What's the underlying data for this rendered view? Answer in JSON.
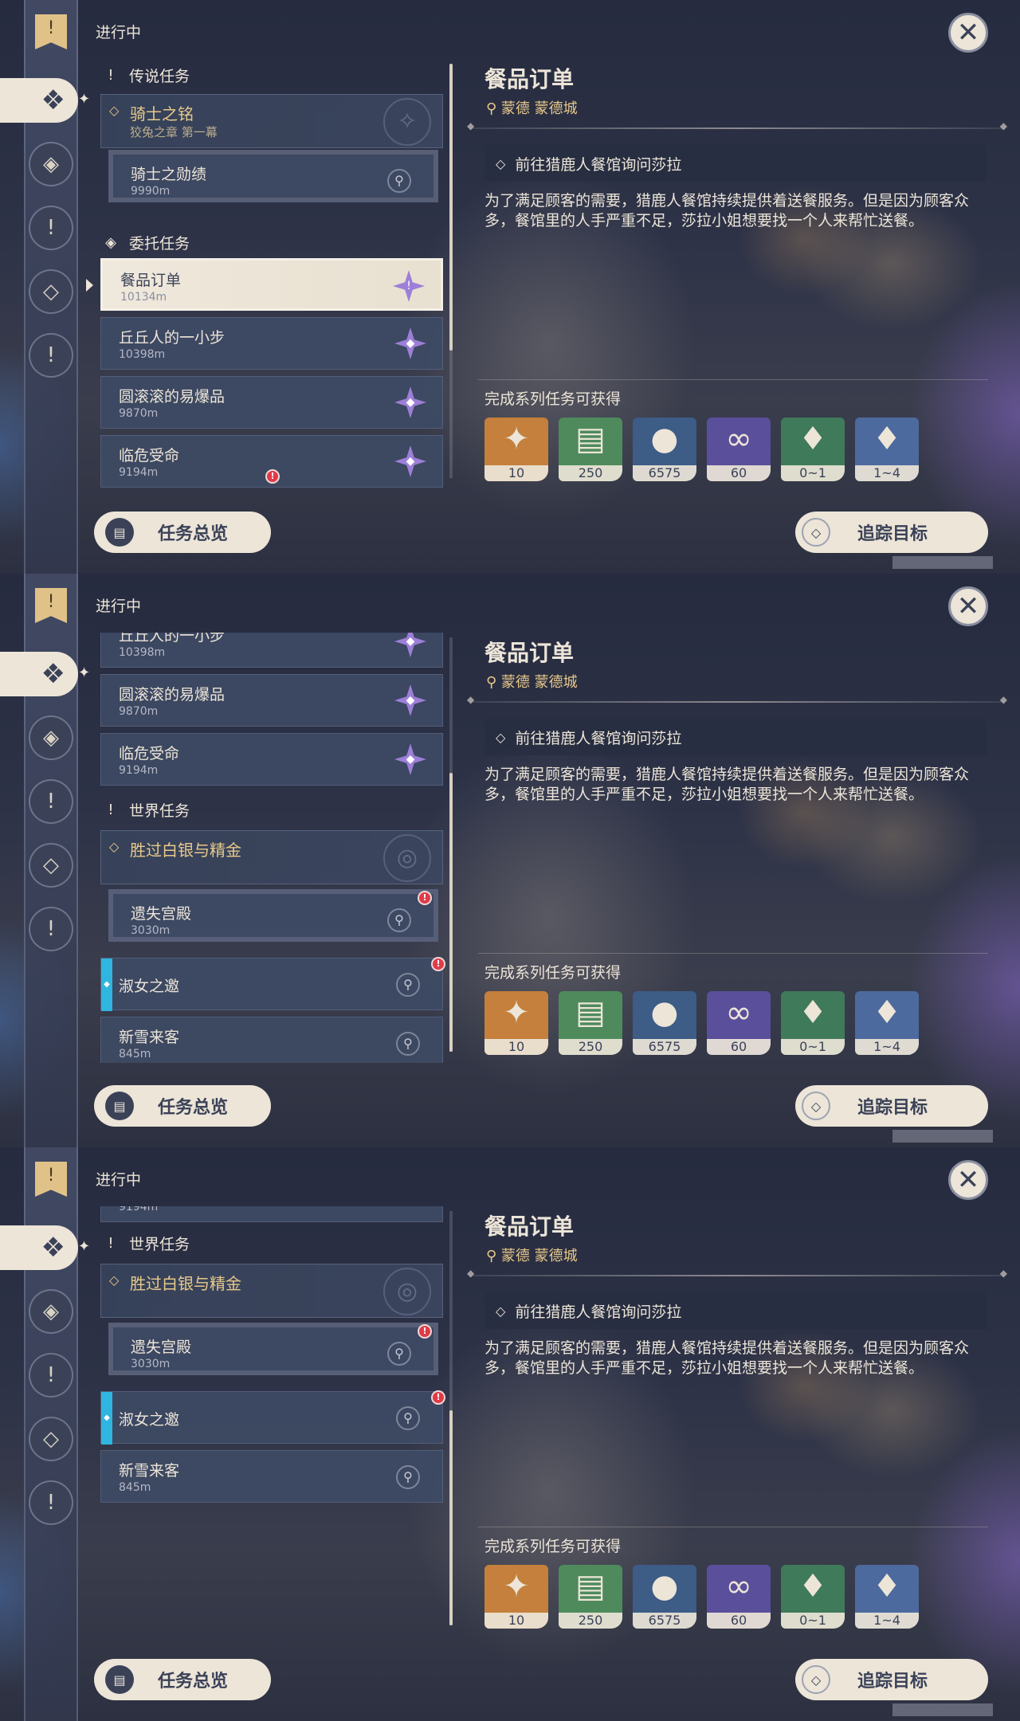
{
  "common": {
    "status": "进行中",
    "close_icon": "✕",
    "detail": {
      "title": "餐品订单",
      "location": "蒙德 蒙德城",
      "objective": "前往猎鹿人餐馆询问莎拉",
      "description": "为了满足顾客的需要，猎鹿人餐馆持续提供着送餐服务。但是因为顾客众多，餐馆里的人手严重不足，莎拉小姐想要找一个人来帮忙送餐。",
      "reward_label": "完成系列任务可获得"
    },
    "rewards": [
      {
        "name": "primogem",
        "count": "10",
        "color": "#c4803c"
      },
      {
        "name": "adventure-exp",
        "count": "250",
        "color": "#4e8a5c"
      },
      {
        "name": "mora",
        "count": "6575",
        "color": "#3d5c86"
      },
      {
        "name": "companionship-exp",
        "count": "60",
        "color": "#5a4f9a"
      },
      {
        "name": "crystal-chunk",
        "count": "0~1",
        "color": "#3f7a5a"
      },
      {
        "name": "mystic-ore",
        "count": "1~4",
        "color": "#4d6a9e"
      }
    ],
    "buttons": {
      "overview": "任务总览",
      "track": "追踪目标"
    }
  },
  "cats": {
    "legend": "传说任务",
    "commission": "委托任务",
    "world": "世界任务"
  },
  "quests": {
    "legend_series": {
      "title": "骑士之铭",
      "sub": "狡兔之章 第一幕"
    },
    "knight": {
      "title": "骑士之勋绩",
      "dist": "9990m"
    },
    "meal": {
      "title": "餐品订单",
      "dist": "10134m"
    },
    "hill": {
      "title": "丘丘人的一小步",
      "dist": "10398m"
    },
    "boom": {
      "title": "圆滚滚的易爆品",
      "dist": "9870m"
    },
    "danger": {
      "title": "临危受命",
      "dist": "9194m"
    },
    "world_series": {
      "title": "胜过白银与精金"
    },
    "palace": {
      "title": "遗失宫殿",
      "dist": "3030m"
    },
    "lady": {
      "title": "淑女之邀"
    },
    "snow": {
      "title": "新雪来客",
      "dist": "845m"
    }
  }
}
